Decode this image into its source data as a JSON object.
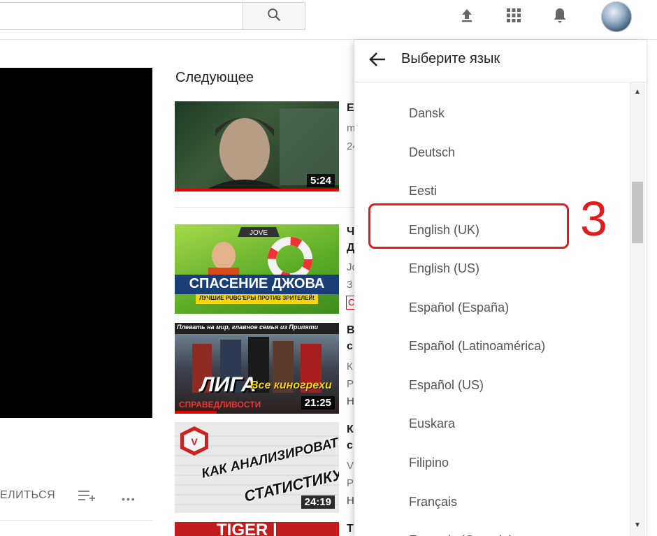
{
  "topbar": {
    "search_placeholder": "",
    "search_icon": "search-icon",
    "upload_icon": "upload-icon",
    "apps_icon": "apps-grid-icon",
    "notifications_icon": "bell-icon"
  },
  "actions": {
    "share_label": "ЕЛИТЬСЯ",
    "more_label": "•••"
  },
  "up_next": {
    "title": "Следующее",
    "items": [
      {
        "duration": "5:24",
        "title_fragment": "E",
        "meta1": "m",
        "meta2": "24"
      },
      {
        "banner_text": "СПАСЕНИЕ ДЖОВА",
        "banner_sub": "ЛУЧШИЕ PUBG'ЕРЫ ПРОТИВ ЗРИТЕЛЕЙ!",
        "logo": "JOVE",
        "title_fragment": "Ч",
        "title_fragment2": "Д",
        "meta1": "Jo",
        "meta2": "3",
        "live_badge": "С"
      },
      {
        "top_text": "Плевать на мир, главное семья из Припяти",
        "big_text": "ЛИГА",
        "sub_text": "Все киногрехи",
        "bottom_text": "СПРАВЕДЛИВОСТИ",
        "duration": "21:25",
        "title_fragment": "В",
        "title_fragment2": "с",
        "meta1": "К",
        "meta2": "Р",
        "meta3": "Н"
      },
      {
        "overlay_text1": "КАК АНАЛИЗИРОВАТЬ",
        "overlay_text2": "СТАТИСТИКУ",
        "duration": "24:19",
        "title_fragment": "К",
        "title_fragment2": "с",
        "meta1": "V",
        "meta2": "Р",
        "meta3": "Н"
      },
      {
        "big_text": "TIGER |",
        "title_fragment": "Т"
      }
    ]
  },
  "language_menu": {
    "title": "Выберите язык",
    "items": [
      "Dansk",
      "Deutsch",
      "Eesti",
      "English (UK)",
      "English (US)",
      "Español (España)",
      "Español (Latinoamérica)",
      "Español (US)",
      "Euskara",
      "Filipino",
      "Français",
      "Français (Canada)"
    ]
  },
  "annotation": {
    "step": "3",
    "color": "#e11c1c"
  }
}
